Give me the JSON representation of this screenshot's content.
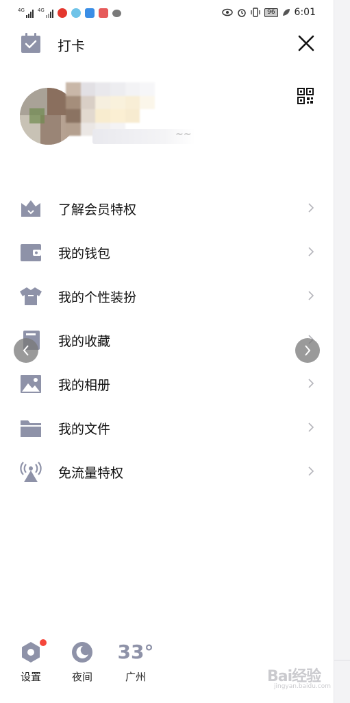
{
  "status_bar": {
    "sim1_label": "4G",
    "sim2_label": "4G",
    "battery": "96",
    "time": "6:01",
    "icons": [
      "eye-icon",
      "alarm-icon",
      "vibrate-icon",
      "leaf-icon"
    ]
  },
  "header": {
    "checkin_label": "打卡",
    "checkin_icon": "calendar-check-icon",
    "close_icon": "close-icon"
  },
  "profile": {
    "signature_tail": "~~",
    "qr_icon": "qr-code-icon"
  },
  "menu": {
    "items": [
      {
        "label": "了解会员特权",
        "icon": "crown-icon"
      },
      {
        "label": "我的钱包",
        "icon": "wallet-icon"
      },
      {
        "label": "我的个性装扮",
        "icon": "shirt-icon"
      },
      {
        "label": "我的收藏",
        "icon": "bookmark-icon"
      },
      {
        "label": "我的相册",
        "icon": "photo-icon"
      },
      {
        "label": "我的文件",
        "icon": "folder-icon"
      },
      {
        "label": "免流量特权",
        "icon": "signal-tower-icon"
      }
    ]
  },
  "bottom": {
    "settings_label": "设置",
    "night_label": "夜间",
    "weather_temp": "33°",
    "weather_city": "广州"
  },
  "watermark": {
    "text": "Bai经验",
    "sub": "jingyan.baidu.com"
  },
  "colors": {
    "icon_gray": "#8e92a8",
    "badge_red": "#f5473b",
    "text": "#111111"
  }
}
